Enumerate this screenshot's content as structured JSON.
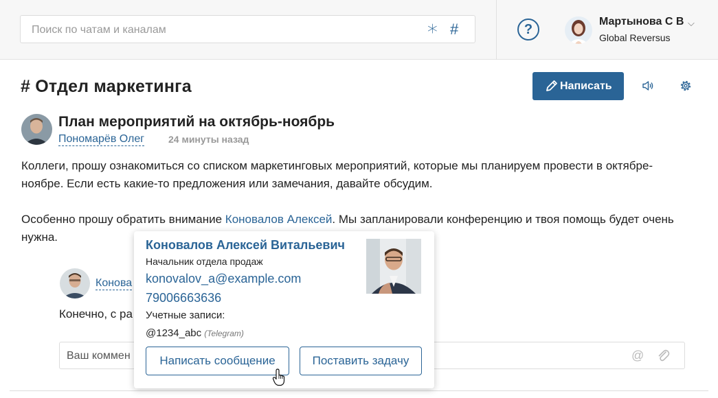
{
  "header": {
    "search_placeholder": "Поиск по чатам и каналам",
    "search_asterisk": "∗",
    "search_hash": "#",
    "help_symbol": "?",
    "user_name": "Мартынова С В",
    "user_chevron": "⌵",
    "user_company": "Global Reversus"
  },
  "channel": {
    "title": "# Отдел маркетинга",
    "write_button": "Написать"
  },
  "post": {
    "title": "План мероприятий на октябрь-ноябрь",
    "author": "Пономарёв Олег",
    "time": "24 минуты назад",
    "paragraph1": "Коллеги, прошу ознакомиться со списком маркетинговых мероприятий, которые мы планируем провести в октябре-ноябре. Если есть какие-то предложения или замечания, давайте обсудим.",
    "paragraph2_before": "Особенно прошу обратить внимание ",
    "paragraph2_mention": "Коновалов Алексей",
    "paragraph2_after": ". Мы запланировали конференцию и твоя помощь будет очень нужна."
  },
  "reply": {
    "author": "Конова",
    "text": "Конечно, с ра",
    "comment_placeholder": "Ваш коммен",
    "at_symbol": "@"
  },
  "popup": {
    "name": "Коновалов Алексей Витальевич",
    "position": "Начальник отдела продаж",
    "email": "konovalov_a@example.com",
    "phone": "79006663636",
    "accounts_label": "Учетные записи:",
    "handle": "@1234_abc",
    "service": "(Telegram)",
    "message_button": "Написать сообщение",
    "task_button": "Поставить задачу"
  },
  "colors": {
    "accent": "#2a6496",
    "topbar_bg": "#f7f7f7"
  }
}
